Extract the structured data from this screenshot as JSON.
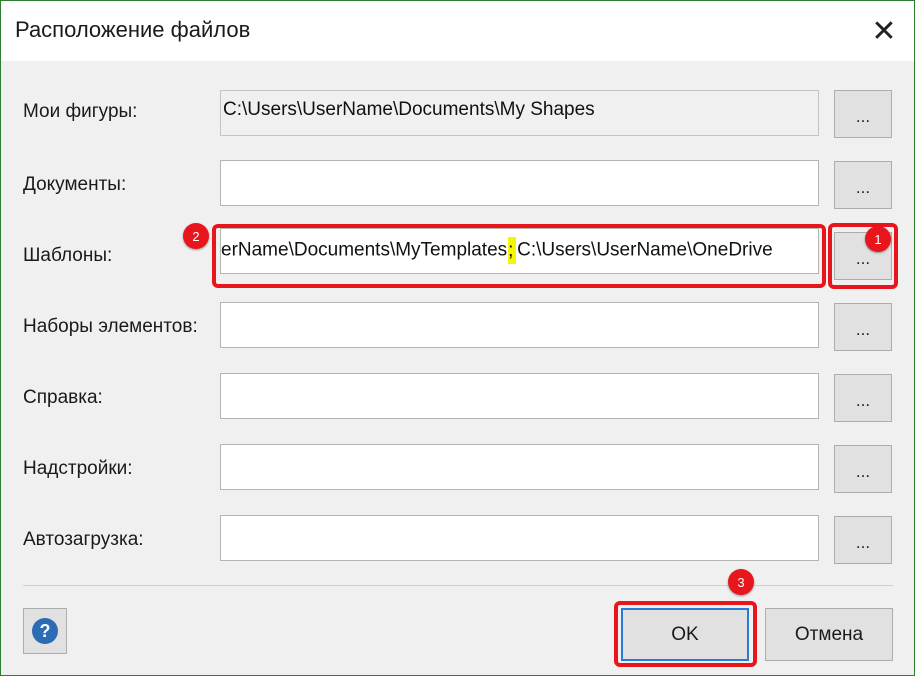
{
  "dialog": {
    "title": "Расположение файлов",
    "close_glyph": "✕"
  },
  "rows": [
    {
      "label": "Мои фигуры:",
      "value": "C:\\Users\\UserName\\Documents\\My Shapes",
      "browse": "..."
    },
    {
      "label": "Документы:",
      "value": "",
      "browse": "..."
    },
    {
      "label": "Шаблоны:",
      "value_before": "erName\\Documents\\MyTemplates",
      "value_sep": ";",
      "value_after": "C:\\Users\\UserName\\OneDrive",
      "browse": "..."
    },
    {
      "label": "Наборы элементов:",
      "value": "",
      "browse": "..."
    },
    {
      "label": "Справка:",
      "value": "",
      "browse": "..."
    },
    {
      "label": "Надстройки:",
      "value": "",
      "browse": "..."
    },
    {
      "label": "Автозагрузка:",
      "value": "",
      "browse": "..."
    }
  ],
  "footer": {
    "help_glyph": "?",
    "ok_label": "OK",
    "cancel_label": "Отмена"
  },
  "annotations": {
    "badge1": "1",
    "badge2": "2",
    "badge3": "3",
    "highlight_color": "#e8151d"
  },
  "icons": [
    "close-icon",
    "help-icon"
  ]
}
